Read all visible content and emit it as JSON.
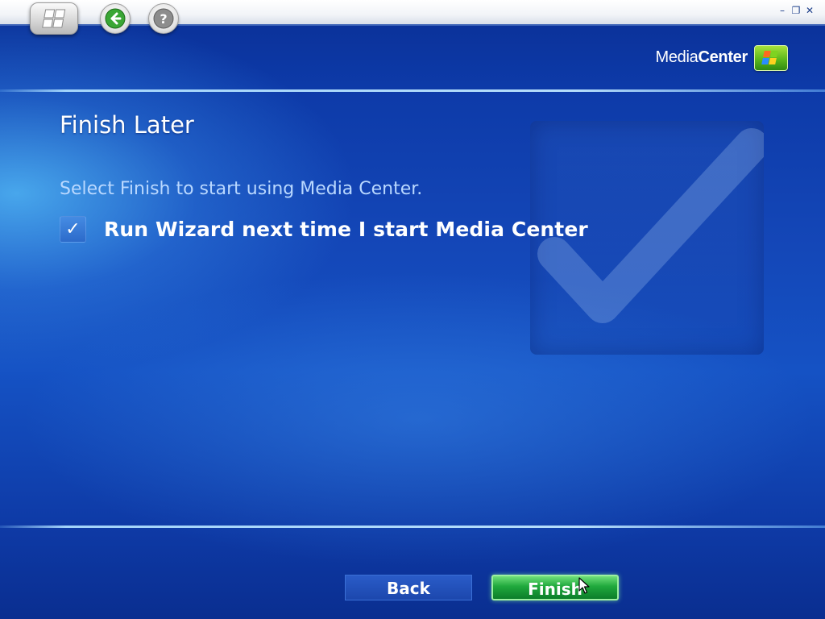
{
  "window": {
    "controls": {
      "minimize": "–",
      "restore": "❐",
      "close": "✕"
    }
  },
  "brand": {
    "media": "Media",
    "center": "Center"
  },
  "wizard": {
    "title": "Finish Later",
    "instruction": "Select Finish to start using Media Center.",
    "option": {
      "label": "Run Wizard next time I start Media Center",
      "checked": true,
      "check_glyph": "✓"
    }
  },
  "buttons": {
    "back": "Back",
    "finish": "Finish"
  },
  "icons": {
    "start": "windows-logo-icon",
    "back_nav": "back-arrow-icon",
    "help": "help-question-icon",
    "watermark": "checkmark-watermark-icon",
    "brand_logo": "windows-flag-icon",
    "cursor": "mouse-pointer-icon"
  },
  "colors": {
    "background": "#1447b8",
    "finish_button": "#1fa83c",
    "back_button": "#1c47ad",
    "instruction_text": "#b9d8ff",
    "nav_arrow": "#3aa635"
  }
}
